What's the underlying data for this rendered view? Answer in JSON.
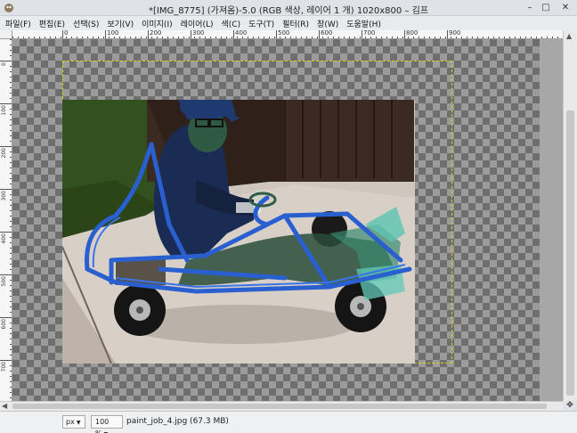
{
  "window": {
    "title": "*[IMG_8775] (가져옴)-5.0 (RGB 색상, 레이어 1 개) 1020x800 – 김프",
    "minimize": "–",
    "maximize": "□",
    "close": "✕"
  },
  "menu": {
    "items": [
      "파일(F)",
      "편집(E)",
      "선택(S)",
      "보기(V)",
      "이미지(I)",
      "레이어(L)",
      "색(C)",
      "도구(T)",
      "필터(R)",
      "창(W)",
      "도움말(H)"
    ]
  },
  "ruler": {
    "h_labels": [
      "0",
      "100",
      "200",
      "300",
      "400",
      "500",
      "600",
      "700",
      "800",
      "900"
    ],
    "v_labels": [
      "0",
      "100",
      "200",
      "300",
      "400",
      "500",
      "600",
      "700",
      "800"
    ]
  },
  "status": {
    "unit": "px",
    "zoom": "100 %",
    "file_info": "paint_job_4.jpg (67.3 MB)"
  },
  "colors": {
    "guide": "#d8d400",
    "kart": "#2a5fd0",
    "hoodie": "#1b2c54"
  },
  "icons": {
    "app": "gimp-icon",
    "navigate": "navigate-icon"
  }
}
